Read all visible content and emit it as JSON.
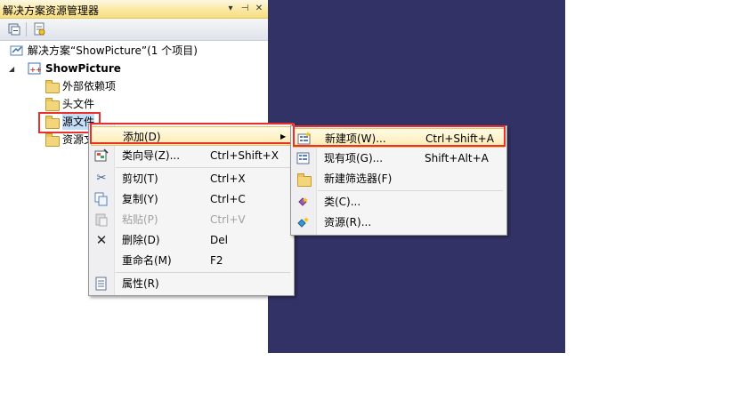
{
  "panel": {
    "title": "解决方案资源管理器",
    "title_buttons": [
      "▾",
      "⊣",
      "✕"
    ],
    "tree": {
      "solution": "解决方案“ShowPicture”(1 个项目)",
      "project": "ShowPicture",
      "folders": [
        "外部依赖项",
        "头文件",
        "源文件",
        "资源文"
      ]
    }
  },
  "context_menu": {
    "items": [
      {
        "label": "添加(D)",
        "shortcut": "",
        "icon": "none",
        "submenu": true
      },
      {
        "label": "类向导(Z)...",
        "shortcut": "Ctrl+Shift+X",
        "icon": "class-wizard-icon"
      },
      {
        "label": "剪切(T)",
        "shortcut": "Ctrl+X",
        "icon": "scissors-icon"
      },
      {
        "label": "复制(Y)",
        "shortcut": "Ctrl+C",
        "icon": "copy-icon"
      },
      {
        "label": "粘贴(P)",
        "shortcut": "Ctrl+V",
        "icon": "paste-icon",
        "disabled": true
      },
      {
        "label": "删除(D)",
        "shortcut": "Del",
        "icon": "delete-x-icon"
      },
      {
        "label": "重命名(M)",
        "shortcut": "F2",
        "icon": "none"
      },
      {
        "label": "属性(R)",
        "shortcut": "",
        "icon": "properties-icon"
      }
    ]
  },
  "submenu": {
    "items": [
      {
        "label": "新建项(W)...",
        "shortcut": "Ctrl+Shift+A",
        "icon": "new-item-icon"
      },
      {
        "label": "现有项(G)...",
        "shortcut": "Shift+Alt+A",
        "icon": "existing-item-icon"
      },
      {
        "label": "新建筛选器(F)",
        "shortcut": "",
        "icon": "new-filter-folder-icon"
      },
      {
        "label": "类(C)...",
        "shortcut": "",
        "icon": "class-icon"
      },
      {
        "label": "资源(R)...",
        "shortcut": "",
        "icon": "resource-icon"
      }
    ]
  },
  "colors": {
    "annotation_red": "#e8302c",
    "background_navy": "#333266",
    "highlight": "#fdebb0"
  }
}
